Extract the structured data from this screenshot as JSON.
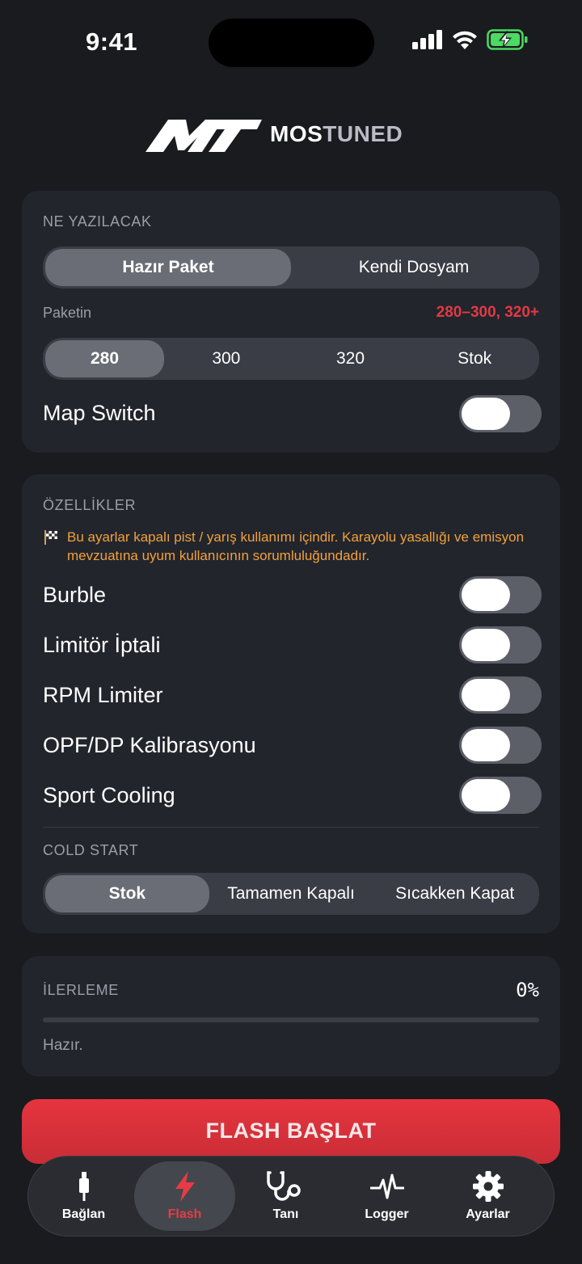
{
  "status_bar": {
    "time": "9:41"
  },
  "logo": {
    "word_a": "MOS",
    "word_b": "TUNED"
  },
  "write_section": {
    "label": "NE YAZILACAK",
    "source_tabs": [
      {
        "label": "Hazır Paket",
        "active": true
      },
      {
        "label": "Kendi Dosyam",
        "active": false
      }
    ],
    "package_label": "Paketin",
    "package_value": "280–300, 320+",
    "packages": [
      {
        "label": "280",
        "active": true
      },
      {
        "label": "300",
        "active": false
      },
      {
        "label": "320",
        "active": false
      },
      {
        "label": "Stok",
        "active": false
      }
    ],
    "map_switch_label": "Map Switch"
  },
  "features_section": {
    "label": "ÖZELLİKLER",
    "warning": "Bu ayarlar kapalı pist / yarış kullanımı içindir. Karayolu yasallığı ve emisyon mevzuatına uyum kullanıcının sorumluluğundadır.",
    "items": [
      {
        "label": "Burble"
      },
      {
        "label": "Limitör İptali"
      },
      {
        "label": "RPM Limiter"
      },
      {
        "label": "OPF/DP Kalibrasyonu"
      },
      {
        "label": "Sport Cooling"
      }
    ],
    "cold_start_label": "COLD START",
    "cold_start_options": [
      {
        "label": "Stok",
        "active": true
      },
      {
        "label": "Tamamen Kapalı",
        "active": false
      },
      {
        "label": "Sıcakken Kapat",
        "active": false
      }
    ]
  },
  "progress_section": {
    "label": "İLERLEME",
    "percent_text": "0%",
    "progress": 0,
    "status": "Hazır."
  },
  "flash_button": {
    "label": "FLASH BAŞLAT"
  },
  "tabbar": {
    "tabs": [
      {
        "label": "Bağlan",
        "icon": "connector-icon",
        "active": false
      },
      {
        "label": "Flash",
        "icon": "bolt-icon",
        "active": true
      },
      {
        "label": "Tanı",
        "icon": "stethoscope-icon",
        "active": false
      },
      {
        "label": "Logger",
        "icon": "pulse-icon",
        "active": false
      },
      {
        "label": "Ayarlar",
        "icon": "gear-icon",
        "active": false
      }
    ]
  },
  "colors": {
    "accent": "#e23a44",
    "warning": "#f2a13b",
    "card": "#22252c",
    "background": "#1a1b1f"
  }
}
